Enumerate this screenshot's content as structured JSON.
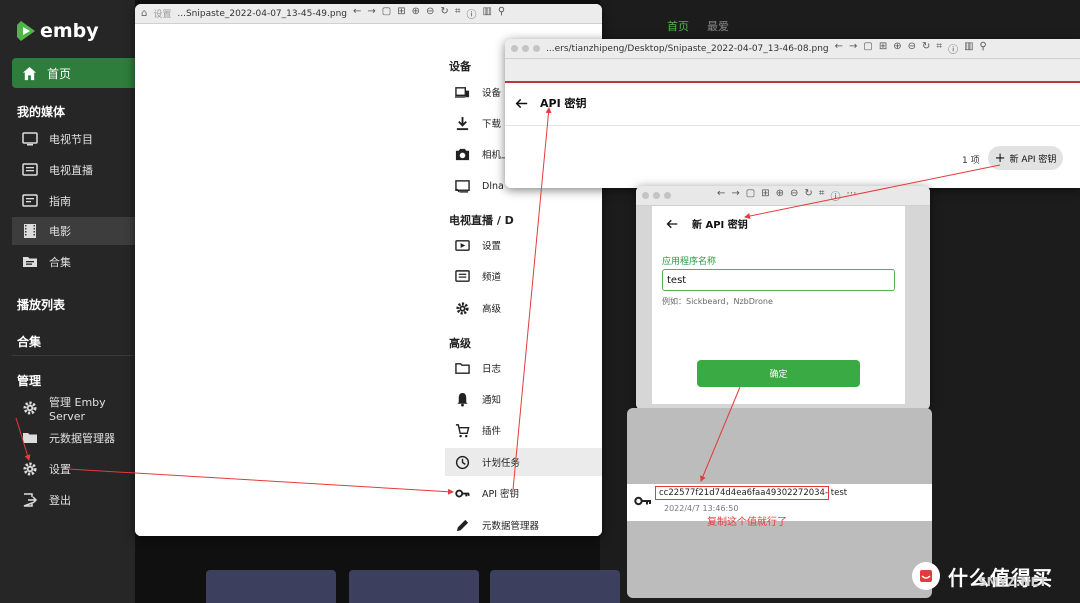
{
  "emby": {
    "logo_text": "emby",
    "home_label": "首页",
    "media_header": "我的媒体",
    "media_items": [
      "电视节目",
      "电视直播",
      "指南",
      "电影",
      "合集"
    ],
    "playlist_header": "播放列表",
    "collection_header": "合集",
    "manage_header": "管理",
    "manage_items": [
      "管理 Emby Server",
      "元数据管理器",
      "设置",
      "登出"
    ],
    "bg_tabs": [
      "首页",
      "最爱"
    ],
    "accent": "#52b54b"
  },
  "win1": {
    "filename": "...Snipaste_2022-04-07_13-45-49.png",
    "titlebar_label": "设置",
    "sections": [
      {
        "header": "设备",
        "items": [
          "设备",
          "下载",
          "相机上",
          "Dlna"
        ]
      },
      {
        "header": "电视直播 / D",
        "items": [
          "设置",
          "频道",
          "高级"
        ]
      },
      {
        "header": "高级",
        "items": [
          "日志",
          "通知",
          "插件",
          "计划任务",
          "API 密钥",
          "元数据管理器"
        ]
      }
    ]
  },
  "win2": {
    "filename": "...ers/tianzhipeng/Desktop/Snipaste_2022-04-07_13-46-08.png",
    "title": "API 密钥",
    "count": "1 项",
    "new_button": "新 API 密钥"
  },
  "win3": {
    "title": "新 API 密钥",
    "field_label": "应用程序名称",
    "field_value": "test",
    "hint": "例如：Sickbeard，NzbDrone",
    "ok_button": "确定"
  },
  "win4": {
    "key": "cc22577f21d74d4ea6faa49302272034",
    "name": "- test",
    "date": "2022/4/7 13:46:50",
    "annotation": "复制这个值就行了"
  },
  "watermark": {
    "text": "什么值得买",
    "sub": "SMYZ.NET"
  },
  "annotation_color": "#e23c3c"
}
